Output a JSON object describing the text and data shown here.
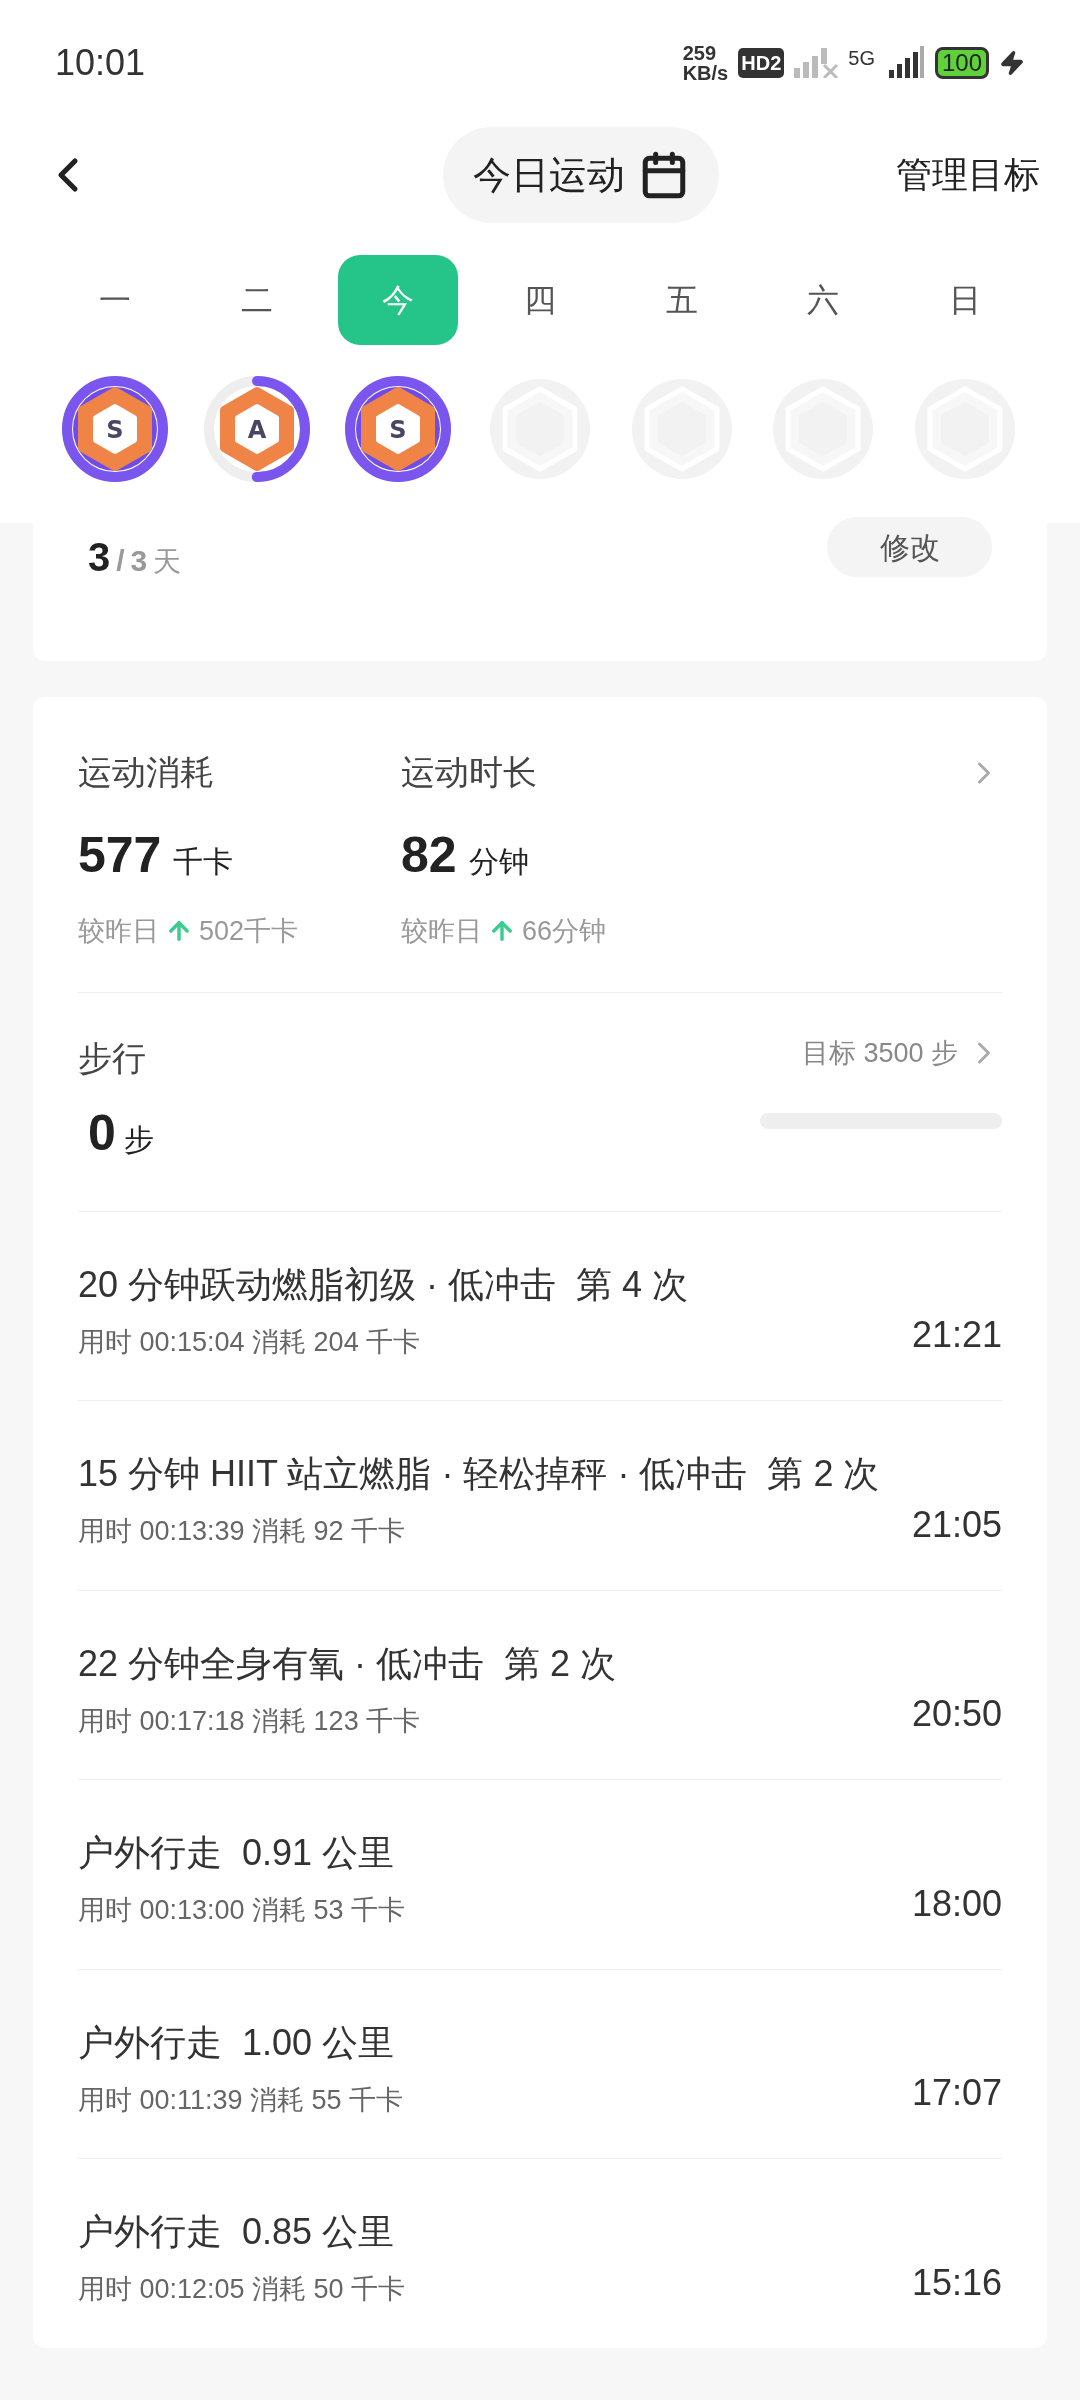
{
  "status_bar": {
    "time": "10:01",
    "speed_value": "259",
    "speed_unit": "KB/s",
    "hd": "HD2",
    "network": "5G",
    "battery": "100"
  },
  "header": {
    "title": "今日运动",
    "manage": "管理目标"
  },
  "days": [
    {
      "label": "一",
      "selected": false
    },
    {
      "label": "二",
      "selected": false
    },
    {
      "label": "今",
      "selected": true
    },
    {
      "label": "四",
      "selected": false
    },
    {
      "label": "五",
      "selected": false
    },
    {
      "label": "六",
      "selected": false
    },
    {
      "label": "日",
      "selected": false
    }
  ],
  "badges": [
    {
      "kind": "full",
      "grade": "S"
    },
    {
      "kind": "partial",
      "grade": "A"
    },
    {
      "kind": "full",
      "grade": "S"
    },
    {
      "kind": "empty"
    },
    {
      "kind": "empty"
    },
    {
      "kind": "empty"
    },
    {
      "kind": "empty"
    }
  ],
  "goal_card": {
    "done": "3",
    "separator": "/",
    "total": "3",
    "unit": "天",
    "button": "修改"
  },
  "metrics": [
    {
      "label": "运动消耗",
      "value": "577",
      "unit": "千卡",
      "compare": "较昨日",
      "delta": "502千卡"
    },
    {
      "label": "运动时长",
      "value": "82",
      "unit": "分钟",
      "compare": "较昨日",
      "delta": "66分钟"
    }
  ],
  "steps": {
    "label": "步行",
    "value": "0",
    "unit": "步",
    "target": "目标 3500 步"
  },
  "workouts": [
    {
      "title": "20 分钟跃动燃脂初级 · 低冲击",
      "count": "第 4 次",
      "detail": "用时 00:15:04 消耗 204 千卡",
      "time": "21:21"
    },
    {
      "title": "15 分钟 HIIT 站立燃脂 · 轻松掉秤 · 低冲击",
      "count": "第 2 次",
      "detail": "用时 00:13:39 消耗 92 千卡",
      "time": "21:05"
    },
    {
      "title": "22 分钟全身有氧 · 低冲击",
      "count": "第 2 次",
      "detail": "用时 00:17:18 消耗 123 千卡",
      "time": "20:50"
    },
    {
      "title": "户外行走",
      "count": "0.91 公里",
      "detail": "用时 00:13:00 消耗 53 千卡",
      "time": "18:00"
    },
    {
      "title": "户外行走",
      "count": "1.00 公里",
      "detail": "用时 00:11:39 消耗 55 千卡",
      "time": "17:07"
    },
    {
      "title": "户外行走",
      "count": "0.85 公里",
      "detail": "用时 00:12:05 消耗 50 千卡",
      "time": "15:16"
    }
  ]
}
